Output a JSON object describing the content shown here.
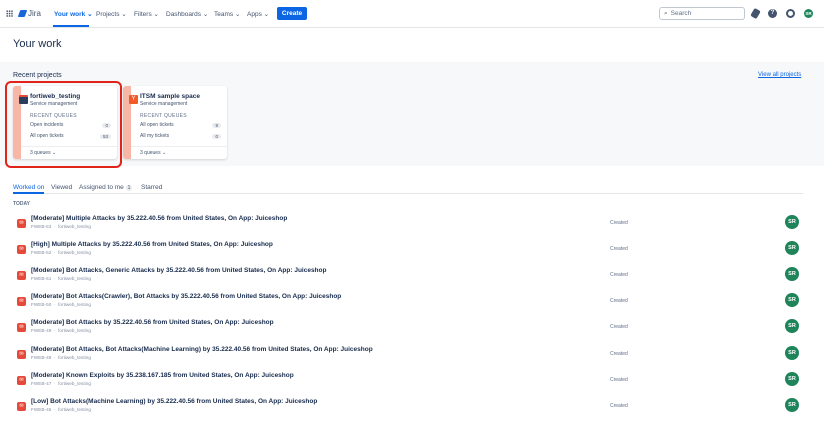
{
  "nav": {
    "app": "Jira",
    "items": [
      "Your work",
      "Projects",
      "Filters",
      "Dashboards",
      "Teams",
      "Apps"
    ],
    "create": "Create",
    "search_placeholder": "Search",
    "avatar": "SR"
  },
  "page_title": "Your work",
  "recent": {
    "heading": "Recent projects",
    "view_all": "View all projects",
    "projects": [
      {
        "name": "fortiweb_testing",
        "type": "Service management",
        "queues_label": "RECENT QUEUES",
        "queues": [
          {
            "label": "Open incidents",
            "count": "0"
          },
          {
            "label": "All open tickets",
            "count": "53"
          }
        ],
        "footer": "3 queues ⌄"
      },
      {
        "name": "ITSM sample space",
        "type": "Service management",
        "queues_label": "RECENT QUEUES",
        "queues": [
          {
            "label": "All open tickets",
            "count": "9"
          },
          {
            "label": "All my tickets",
            "count": "0"
          }
        ],
        "footer": "3 queues ⌄"
      }
    ]
  },
  "tabs": [
    {
      "label": "Worked on"
    },
    {
      "label": "Viewed"
    },
    {
      "label": "Assigned to me",
      "count": "1"
    },
    {
      "label": "Starred"
    }
  ],
  "section": "TODAY",
  "items": [
    {
      "title": "[Moderate] Multiple Attacks by 35.222.40.56 from United States, On App: Juiceshop",
      "key": "FWEB-53",
      "project": "fortiweb_testing",
      "status": "Created",
      "avatar": "SR"
    },
    {
      "title": "[High] Multiple Attacks by 35.222.40.56 from United States, On App: Juiceshop",
      "key": "FWEB-52",
      "project": "fortiweb_testing",
      "status": "Created",
      "avatar": "SR"
    },
    {
      "title": "[Moderate] Bot Attacks, Generic Attacks by 35.222.40.56 from United States, On App: Juiceshop",
      "key": "FWEB-51",
      "project": "fortiweb_testing",
      "status": "Created",
      "avatar": "SR"
    },
    {
      "title": "[Moderate] Bot Attacks(Crawler), Bot Attacks by 35.222.40.56 from United States, On App: Juiceshop",
      "key": "FWEB-50",
      "project": "fortiweb_testing",
      "status": "Created",
      "avatar": "SR"
    },
    {
      "title": "[Moderate] Bot Attacks by 35.222.40.56 from United States, On App: Juiceshop",
      "key": "FWEB-49",
      "project": "fortiweb_testing",
      "status": "Created",
      "avatar": "SR"
    },
    {
      "title": "[Moderate] Bot Attacks, Bot Attacks(Machine Learning) by 35.222.40.56 from United States, On App: Juiceshop",
      "key": "FWEB-48",
      "project": "fortiweb_testing",
      "status": "Created",
      "avatar": "SR"
    },
    {
      "title": "[Moderate] Known Exploits by 35.238.167.185 from United States, On App: Juiceshop",
      "key": "FWEB-47",
      "project": "fortiweb_testing",
      "status": "Created",
      "avatar": "SR"
    },
    {
      "title": "[Low] Bot Attacks(Machine Learning) by 35.222.40.56 from United States, On App: Juiceshop",
      "key": "FWEB-46",
      "project": "fortiweb_testing",
      "status": "Created",
      "avatar": "SR"
    }
  ]
}
